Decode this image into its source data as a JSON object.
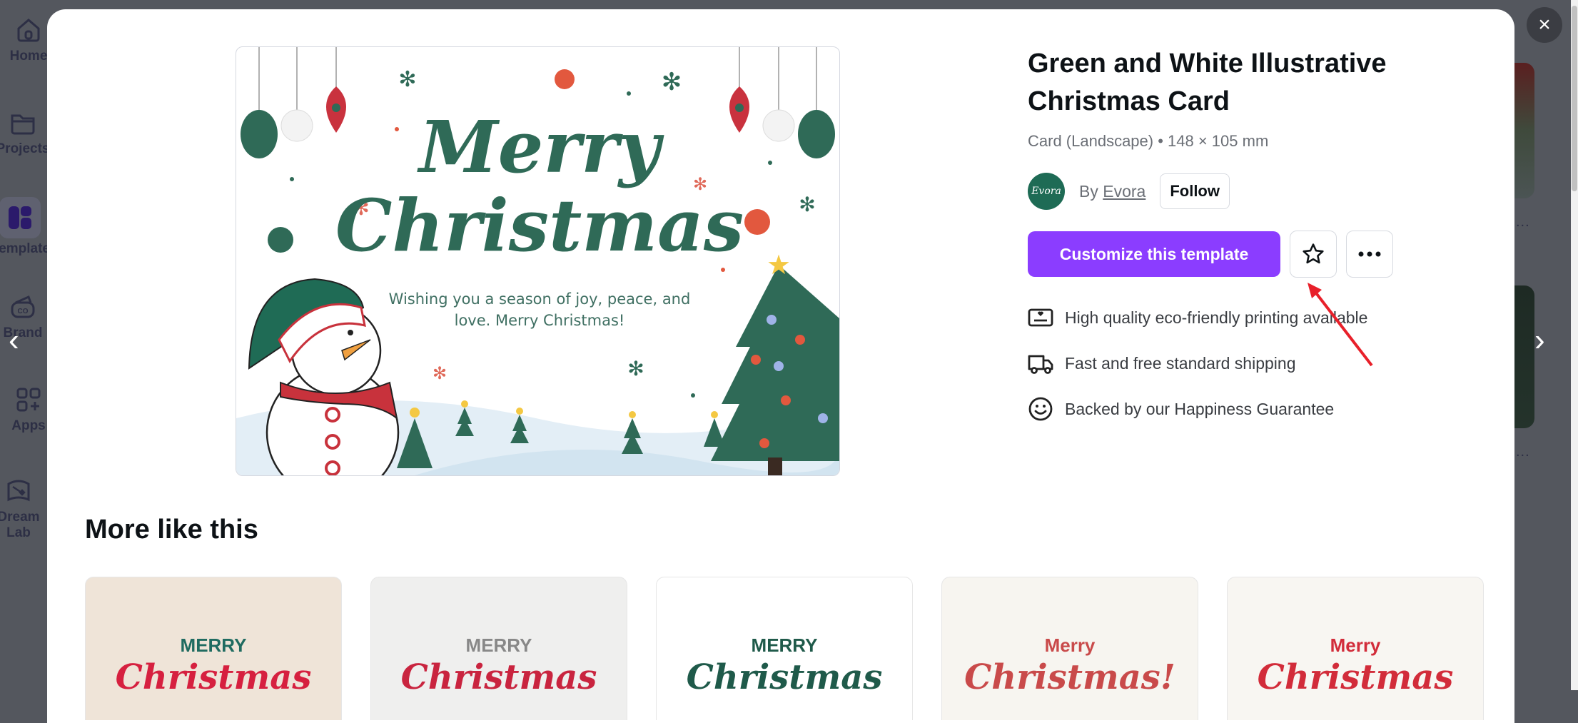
{
  "sidebar": {
    "items": [
      {
        "label": "Home",
        "icon": "home-icon"
      },
      {
        "label": "Projects",
        "icon": "folder-icon"
      },
      {
        "label": "Templates",
        "icon": "templates-icon",
        "active": true
      },
      {
        "label": "Brand",
        "icon": "brand-icon"
      },
      {
        "label": "Apps",
        "icon": "apps-icon"
      },
      {
        "label": "Dream Lab",
        "icon": "dream-lab-icon"
      }
    ]
  },
  "modal": {
    "close_icon": "×",
    "prev_icon": "‹",
    "next_icon": "›",
    "preview": {
      "headline_line1": "Merry",
      "headline_line2": "Christmas",
      "message_line1": "Wishing you a season of joy, peace, and",
      "message_line2": "love. Merry Christmas!"
    },
    "title": "Green and White Illustrative Christmas Card",
    "meta": "Card (Landscape) • 148 × 105 mm",
    "author": {
      "avatar_text": "Evora",
      "by_label": "By",
      "name": "Evora",
      "follow_label": "Follow"
    },
    "actions": {
      "customize_label": "Customize this template",
      "favorite_icon": "star-icon",
      "more_icon": "more-icon"
    },
    "features": [
      {
        "icon": "print-icon",
        "text": "High quality eco-friendly printing available"
      },
      {
        "icon": "truck-icon",
        "text": "Fast and free standard shipping"
      },
      {
        "icon": "smile-icon",
        "text": "Backed by our Happiness Guarantee"
      }
    ],
    "more_like_this": {
      "title": "More like this",
      "items": [
        {
          "line1": "MERRY",
          "line2": "Christmas",
          "bg": "#efe4d8",
          "c1": "#1f6b60",
          "c2": "#d6203f"
        },
        {
          "line1": "MERRY",
          "line2": "Christmas",
          "bg": "#efefee",
          "c1": "#888888",
          "c2": "#c9243f"
        },
        {
          "line1": "MERRY",
          "line2": "Christmas",
          "bg": "#ffffff",
          "c1": "#1f5a4a",
          "c2": "#1f5a4a"
        },
        {
          "line1": "Merry",
          "line2": "Christmas!",
          "bg": "#f7f5f0",
          "c1": "#c94a4a",
          "c2": "#c94a4a"
        },
        {
          "line1": "Merry",
          "line2": "Christmas",
          "bg": "#f8f6f2",
          "c1": "#d22c3a",
          "c2": "#d22c3a"
        }
      ]
    }
  },
  "colors": {
    "accent": "#8b3dff",
    "overlay": "#54575e",
    "card_green": "#2f6a57"
  }
}
